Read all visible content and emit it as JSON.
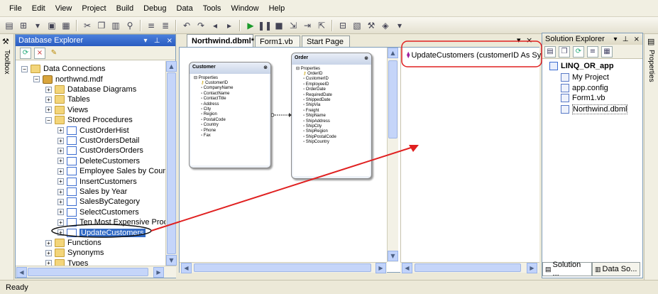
{
  "menu": [
    "File",
    "Edit",
    "View",
    "Project",
    "Build",
    "Debug",
    "Data",
    "Tools",
    "Window",
    "Help"
  ],
  "toolbox_label": "Toolbox",
  "properties_label": "Properties",
  "db_explorer": {
    "title": "Database Explorer",
    "pin": "↓ d ×",
    "tree": [
      {
        "label": "Data Connections",
        "level": 0,
        "exp": "−",
        "icon": "folder"
      },
      {
        "label": "northwnd.mdf",
        "level": 1,
        "exp": "−",
        "icon": "db"
      },
      {
        "label": "Database Diagrams",
        "level": 2,
        "exp": "+",
        "icon": "folder"
      },
      {
        "label": "Tables",
        "level": 2,
        "exp": "+",
        "icon": "folder"
      },
      {
        "label": "Views",
        "level": 2,
        "exp": "+",
        "icon": "folder"
      },
      {
        "label": "Stored Procedures",
        "level": 2,
        "exp": "−",
        "icon": "folder"
      },
      {
        "label": "CustOrderHist",
        "level": 3,
        "exp": "+",
        "icon": "sp"
      },
      {
        "label": "CustOrdersDetail",
        "level": 3,
        "exp": "+",
        "icon": "sp"
      },
      {
        "label": "CustOrdersOrders",
        "level": 3,
        "exp": "+",
        "icon": "sp"
      },
      {
        "label": "DeleteCustomers",
        "level": 3,
        "exp": "+",
        "icon": "sp"
      },
      {
        "label": "Employee Sales by Country",
        "level": 3,
        "exp": "+",
        "icon": "sp"
      },
      {
        "label": "InsertCustomers",
        "level": 3,
        "exp": "+",
        "icon": "sp"
      },
      {
        "label": "Sales by Year",
        "level": 3,
        "exp": "+",
        "icon": "sp"
      },
      {
        "label": "SalesByCategory",
        "level": 3,
        "exp": "+",
        "icon": "sp"
      },
      {
        "label": "SelectCustomers",
        "level": 3,
        "exp": "+",
        "icon": "sp"
      },
      {
        "label": "Ten Most Expensive Produ",
        "level": 3,
        "exp": "+",
        "icon": "sp"
      },
      {
        "label": "UpdateCustomers",
        "level": 3,
        "exp": "+",
        "icon": "sp",
        "selected": true
      },
      {
        "label": "Functions",
        "level": 2,
        "exp": "+",
        "icon": "folder"
      },
      {
        "label": "Synonyms",
        "level": 2,
        "exp": "+",
        "icon": "folder"
      },
      {
        "label": "Types",
        "level": 2,
        "exp": "+",
        "icon": "folder"
      }
    ]
  },
  "tabs": [
    {
      "label": "Northwind.dbml*",
      "active": true
    },
    {
      "label": "Form1.vb",
      "active": false
    },
    {
      "label": "Start Page",
      "active": false
    }
  ],
  "designer": {
    "customer": {
      "title": "Customer",
      "section": "Properties",
      "props": [
        "CustomerID",
        "CompanyName",
        "ContactName",
        "ContactTitle",
        "Address",
        "City",
        "Region",
        "PostalCode",
        "Country",
        "Phone",
        "Fax"
      ]
    },
    "order": {
      "title": "Order",
      "section": "Properties",
      "props": [
        "OrderID",
        "CustomerID",
        "EmployeeID",
        "OrderDate",
        "RequiredDate",
        "ShippedDate",
        "ShipVia",
        "Freight",
        "ShipName",
        "ShipAddress",
        "ShipCity",
        "ShipRegion",
        "ShipPostalCode",
        "ShipCountry"
      ]
    },
    "method": "UpdateCustomers (customerID As Syst"
  },
  "solution_explorer": {
    "title": "Solution Explorer",
    "project": "LINQ_OR_app",
    "items": [
      "My Project",
      "app.config",
      "Form1.vb",
      "Northwind.dbml"
    ],
    "bottom_tabs": [
      "Solution ...",
      "Data So..."
    ]
  },
  "status": "Ready",
  "colors": {
    "accent": "#2a5cc0",
    "annotation": "#e02020",
    "selection": "#316ac5"
  }
}
